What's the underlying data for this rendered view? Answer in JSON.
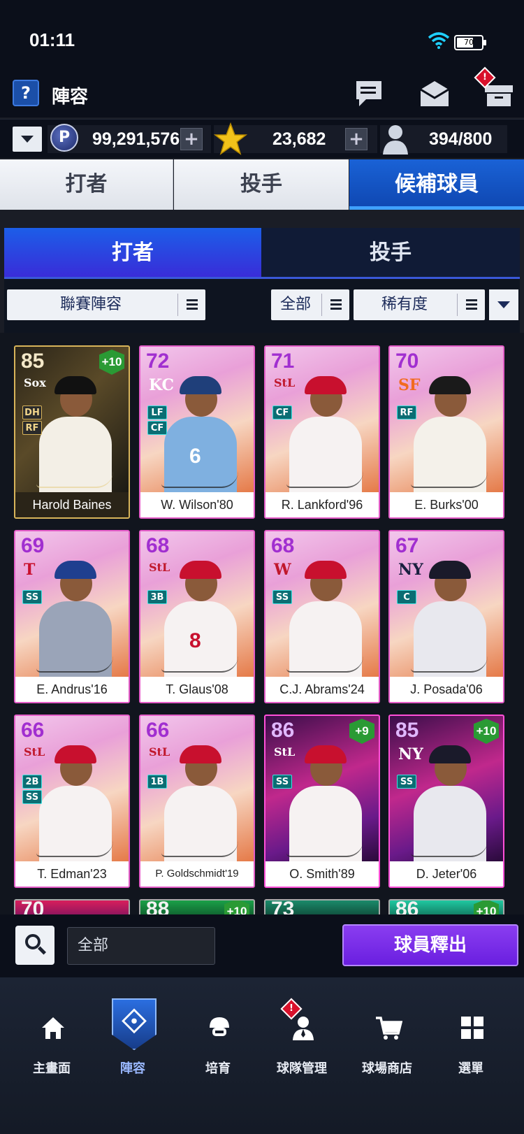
{
  "status_bar": {
    "time": "01:11",
    "battery": "70"
  },
  "header": {
    "help_label": "?",
    "title": "陣容"
  },
  "currency": {
    "points": "99,291,576",
    "points_icon": "P",
    "stars": "23,682",
    "roster": "394/800"
  },
  "main_tabs": [
    {
      "label": "打者",
      "active": false
    },
    {
      "label": "投手",
      "active": false
    },
    {
      "label": "候補球員",
      "active": true
    }
  ],
  "sub_tabs": [
    {
      "label": "打者",
      "active": true
    },
    {
      "label": "投手",
      "active": false
    }
  ],
  "filters": {
    "lineup": "聯賽陣容",
    "all": "全部",
    "rarity": "稀有度"
  },
  "cards": [
    {
      "ovr": "85",
      "logo": "Sox",
      "positions": [
        "DH",
        "RF"
      ],
      "name": "Harold Baines",
      "bonus": "+10",
      "style": "gold"
    },
    {
      "ovr": "72",
      "logo": "KC",
      "positions": [
        "LF",
        "CF"
      ],
      "name": "W. Wilson'80",
      "bonus": "",
      "style": "pink",
      "number": "6"
    },
    {
      "ovr": "71",
      "logo": "StL",
      "positions": [
        "CF"
      ],
      "name": "R. Lankford'96",
      "bonus": "",
      "style": "pink"
    },
    {
      "ovr": "70",
      "logo": "SF",
      "positions": [
        "RF"
      ],
      "name": "E. Burks'00",
      "bonus": "",
      "style": "pink"
    },
    {
      "ovr": "69",
      "logo": "T",
      "positions": [
        "SS"
      ],
      "name": "E. Andrus'16",
      "bonus": "",
      "style": "pink"
    },
    {
      "ovr": "68",
      "logo": "StL",
      "positions": [
        "3B"
      ],
      "name": "T. Glaus'08",
      "bonus": "",
      "style": "pink",
      "number": "8"
    },
    {
      "ovr": "68",
      "logo": "W",
      "positions": [
        "SS"
      ],
      "name": "C.J. Abrams'24",
      "bonus": "",
      "style": "pink"
    },
    {
      "ovr": "67",
      "logo": "NY",
      "positions": [
        "C"
      ],
      "name": "J. Posada'06",
      "bonus": "",
      "style": "pink"
    },
    {
      "ovr": "66",
      "logo": "StL",
      "positions": [
        "2B",
        "SS"
      ],
      "name": "T. Edman'23",
      "bonus": "",
      "style": "pink"
    },
    {
      "ovr": "66",
      "logo": "StL",
      "positions": [
        "1B"
      ],
      "name": "P. Goldschmidt'19",
      "bonus": "",
      "style": "pink"
    },
    {
      "ovr": "86",
      "logo": "StL",
      "positions": [
        "SS"
      ],
      "name": "O. Smith'89",
      "bonus": "+9",
      "style": "fa"
    },
    {
      "ovr": "85",
      "logo": "NY",
      "positions": [
        "SS"
      ],
      "name": "D. Jeter'06",
      "bonus": "+10",
      "style": "fa"
    }
  ],
  "partial_row": [
    {
      "ovr": "70"
    },
    {
      "ovr": "88",
      "bonus": "+10"
    },
    {
      "ovr": "73"
    },
    {
      "ovr": "86",
      "bonus": "+10"
    }
  ],
  "bottom_bar": {
    "search_value": "全部",
    "release_label": "球員釋出"
  },
  "nav": [
    {
      "label": "主畫面",
      "icon": "home-icon"
    },
    {
      "label": "陣容",
      "icon": "lineup-shield-icon",
      "active": true
    },
    {
      "label": "培育",
      "icon": "training-icon"
    },
    {
      "label": "球隊管理",
      "icon": "team-manage-icon",
      "alert": "!"
    },
    {
      "label": "球場商店",
      "icon": "shop-cart-icon"
    },
    {
      "label": "選單",
      "icon": "menu-grid-icon"
    }
  ]
}
